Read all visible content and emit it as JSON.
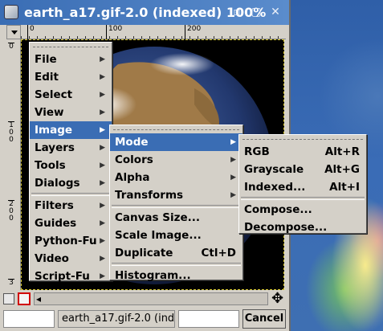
{
  "window": {
    "title": "earth_a17.gif-2.0 (indexed) 100%",
    "wm_buttons": [
      "▫",
      "▢",
      "✕"
    ]
  },
  "ruler": {
    "h_labels": [
      "0",
      "100",
      "200"
    ],
    "v_labels": [
      "0",
      "1\n0\n0",
      "2\n0\n0",
      "3"
    ]
  },
  "status": {
    "text": "earth_a17.gif-2.0 (ind",
    "cancel_label": "Cancel"
  },
  "nav_icon": "✥",
  "menus": {
    "main": [
      {
        "label": "File"
      },
      {
        "label": "Edit"
      },
      {
        "label": "Select"
      },
      {
        "label": "View"
      },
      {
        "label": "Image"
      },
      {
        "label": "Layers"
      },
      {
        "label": "Tools"
      },
      {
        "label": "Dialogs"
      },
      {
        "label": "Filters"
      },
      {
        "label": "Guides"
      },
      {
        "label": "Python-Fu"
      },
      {
        "label": "Video"
      },
      {
        "label": "Script-Fu"
      }
    ],
    "image": [
      {
        "label": "Mode"
      },
      {
        "label": "Colors"
      },
      {
        "label": "Alpha"
      },
      {
        "label": "Transforms"
      },
      {
        "label": "Canvas Size..."
      },
      {
        "label": "Scale Image..."
      },
      {
        "label": "Duplicate",
        "accel": "Ctl+D"
      },
      {
        "label": "Histogram..."
      }
    ],
    "mode": [
      {
        "label": "RGB",
        "accel": "Alt+R"
      },
      {
        "label": "Grayscale",
        "accel": "Alt+G"
      },
      {
        "label": "Indexed...",
        "accel": "Alt+I"
      },
      {
        "label": "Compose..."
      },
      {
        "label": "Decompose..."
      }
    ]
  },
  "colors": {
    "title_bar": "#3a6db4",
    "menu_highlight": "#3a6db4",
    "menu_bg": "#d4d0c8",
    "selection_dash": "#d8c830"
  }
}
